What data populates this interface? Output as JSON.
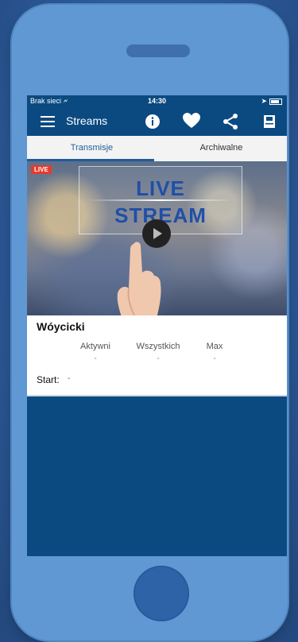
{
  "status": {
    "carrier": "Brak sieci",
    "time": "14:30"
  },
  "toolbar": {
    "title": "Streams"
  },
  "tabs": [
    {
      "label": "Transmisje"
    },
    {
      "label": "Archiwalne"
    }
  ],
  "video": {
    "badge": "LIVE",
    "text_line1": "LIVE",
    "text_line2": "STREAM"
  },
  "stream": {
    "name": "Wóycicki",
    "stats": [
      {
        "label": "Aktywni",
        "value": "-"
      },
      {
        "label": "Wszystkich",
        "value": "-"
      },
      {
        "label": "Max",
        "value": "-"
      }
    ],
    "start_label": "Start:",
    "start_value": "-"
  },
  "colors": {
    "accent": "#1e5d9c",
    "toolbar": "#0b4a80",
    "live": "#e53a2f"
  },
  "icons": [
    "menu-icon",
    "info-icon",
    "heart-icon",
    "share-icon",
    "save-icon",
    "wifi-icon",
    "battery-icon",
    "play-icon"
  ]
}
